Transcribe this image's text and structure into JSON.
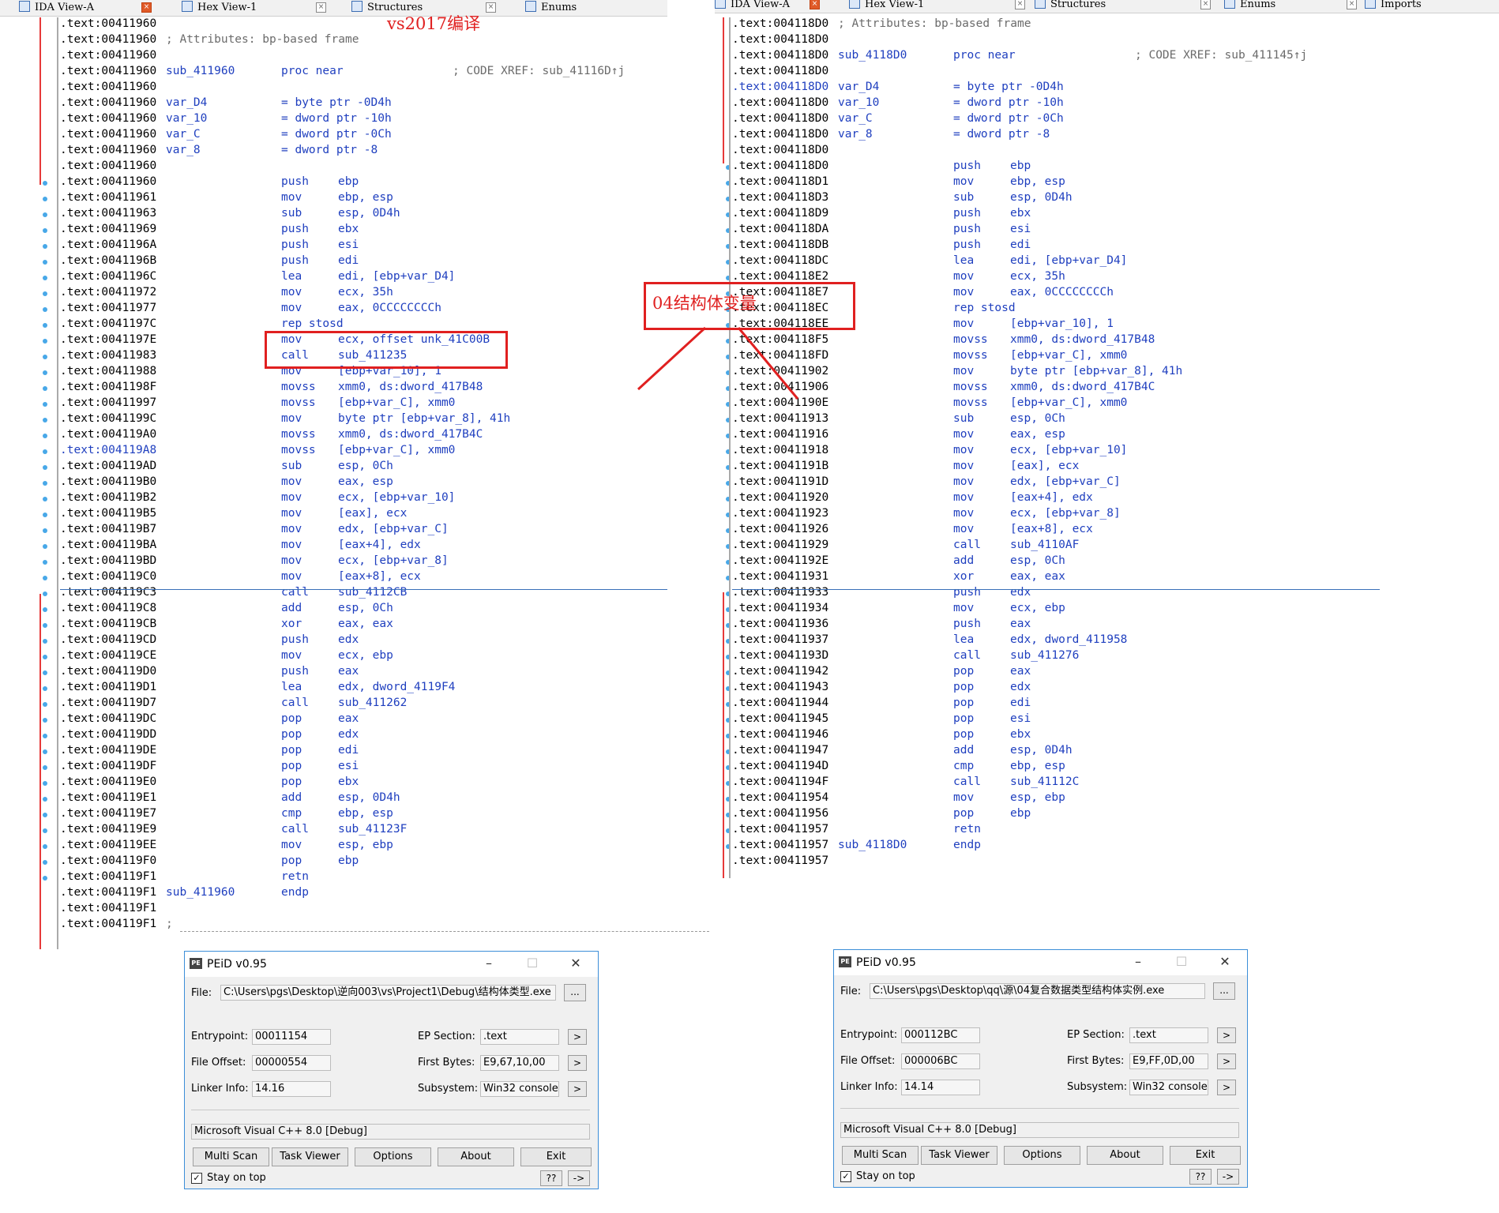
{
  "annotations": {
    "left_title": "vs2017编译",
    "middle_label": "04结构体变量"
  },
  "left": {
    "tabs": [
      {
        "label": "IDA View-A",
        "icon": "ida-view-icon"
      },
      {
        "label": "Hex View-1",
        "icon": "hex-view-icon"
      },
      {
        "label": "Structures",
        "icon": "structures-icon"
      },
      {
        "label": "Enums",
        "icon": "enums-icon"
      }
    ],
    "lines": [
      {
        "a": ".text:00411960",
        "l": "",
        "m": "",
        "o": "",
        "c": ""
      },
      {
        "a": ".text:00411960",
        "l": "",
        "m": "",
        "o": "",
        "c": "; Attributes: bp-based frame"
      },
      {
        "a": ".text:00411960",
        "l": "",
        "m": "",
        "o": "",
        "c": ""
      },
      {
        "a": ".text:00411960",
        "l": "sub_411960",
        "m": "proc near",
        "o": "",
        "c": "; CODE XREF: sub_41116D↑j"
      },
      {
        "a": ".text:00411960",
        "l": "",
        "m": "",
        "o": "",
        "c": ""
      },
      {
        "a": ".text:00411960",
        "l": "var_D4",
        "m": "= byte ptr -0D4h",
        "o": "",
        "c": ""
      },
      {
        "a": ".text:00411960",
        "l": "var_10",
        "m": "= dword ptr -10h",
        "o": "",
        "c": ""
      },
      {
        "a": ".text:00411960",
        "l": "var_C",
        "m": "= dword ptr -0Ch",
        "o": "",
        "c": ""
      },
      {
        "a": ".text:00411960",
        "l": "var_8",
        "m": "= dword ptr -8",
        "o": "",
        "c": ""
      },
      {
        "a": ".text:00411960",
        "l": "",
        "m": "",
        "o": "",
        "c": ""
      },
      {
        "a": ".text:00411960",
        "l": "",
        "m": "push",
        "o": "ebp",
        "c": ""
      },
      {
        "a": ".text:00411961",
        "l": "",
        "m": "mov",
        "o": "ebp, esp",
        "c": ""
      },
      {
        "a": ".text:00411963",
        "l": "",
        "m": "sub",
        "o": "esp, 0D4h",
        "c": ""
      },
      {
        "a": ".text:00411969",
        "l": "",
        "m": "push",
        "o": "ebx",
        "c": ""
      },
      {
        "a": ".text:0041196A",
        "l": "",
        "m": "push",
        "o": "esi",
        "c": ""
      },
      {
        "a": ".text:0041196B",
        "l": "",
        "m": "push",
        "o": "edi",
        "c": ""
      },
      {
        "a": ".text:0041196C",
        "l": "",
        "m": "lea",
        "o": "edi, [ebp+var_D4]",
        "c": ""
      },
      {
        "a": ".text:00411972",
        "l": "",
        "m": "mov",
        "o": "ecx, 35h",
        "c": ""
      },
      {
        "a": ".text:00411977",
        "l": "",
        "m": "mov",
        "o": "eax, 0CCCCCCCCh",
        "c": ""
      },
      {
        "a": ".text:0041197C",
        "l": "",
        "m": "rep stosd",
        "o": "",
        "c": ""
      },
      {
        "a": ".text:0041197E",
        "l": "",
        "m": "mov",
        "o": "ecx, offset unk_41C00B",
        "c": ""
      },
      {
        "a": ".text:00411983",
        "l": "",
        "m": "call",
        "o": "sub_411235",
        "c": ""
      },
      {
        "a": ".text:00411988",
        "l": "",
        "m": "mov",
        "o": "[ebp+var_10], 1",
        "c": ""
      },
      {
        "a": ".text:0041198F",
        "l": "",
        "m": "movss",
        "o": "xmm0, ds:dword_417B48",
        "c": ""
      },
      {
        "a": ".text:00411997",
        "l": "",
        "m": "movss",
        "o": "[ebp+var_C], xmm0",
        "c": ""
      },
      {
        "a": ".text:0041199C",
        "l": "",
        "m": "mov",
        "o": "byte ptr [ebp+var_8], 41h",
        "c": ""
      },
      {
        "a": ".text:004119A0",
        "l": "",
        "m": "movss",
        "o": "xmm0, ds:dword_417B4C",
        "c": ""
      },
      {
        "a": ".text:004119A8",
        "l": "",
        "m": "movss",
        "o": "[ebp+var_C], xmm0",
        "c": "",
        "hl": true
      },
      {
        "a": ".text:004119AD",
        "l": "",
        "m": "sub",
        "o": "esp, 0Ch",
        "c": ""
      },
      {
        "a": ".text:004119B0",
        "l": "",
        "m": "mov",
        "o": "eax, esp",
        "c": ""
      },
      {
        "a": ".text:004119B2",
        "l": "",
        "m": "mov",
        "o": "ecx, [ebp+var_10]",
        "c": ""
      },
      {
        "a": ".text:004119B5",
        "l": "",
        "m": "mov",
        "o": "[eax], ecx",
        "c": ""
      },
      {
        "a": ".text:004119B7",
        "l": "",
        "m": "mov",
        "o": "edx, [ebp+var_C]",
        "c": ""
      },
      {
        "a": ".text:004119BA",
        "l": "",
        "m": "mov",
        "o": "[eax+4], edx",
        "c": ""
      },
      {
        "a": ".text:004119BD",
        "l": "",
        "m": "mov",
        "o": "ecx, [ebp+var_8]",
        "c": ""
      },
      {
        "a": ".text:004119C0",
        "l": "",
        "m": "mov",
        "o": "[eax+8], ecx",
        "c": ""
      },
      {
        "a": ".text:004119C3",
        "l": "",
        "m": "call",
        "o": "sub_4112CB",
        "c": ""
      },
      {
        "a": ".text:004119C8",
        "l": "",
        "m": "add",
        "o": "esp, 0Ch",
        "c": ""
      },
      {
        "a": ".text:004119CB",
        "l": "",
        "m": "xor",
        "o": "eax, eax",
        "c": ""
      },
      {
        "a": ".text:004119CD",
        "l": "",
        "m": "push",
        "o": "edx",
        "c": ""
      },
      {
        "a": ".text:004119CE",
        "l": "",
        "m": "mov",
        "o": "ecx, ebp",
        "c": ""
      },
      {
        "a": ".text:004119D0",
        "l": "",
        "m": "push",
        "o": "eax",
        "c": ""
      },
      {
        "a": ".text:004119D1",
        "l": "",
        "m": "lea",
        "o": "edx, dword_4119F4",
        "c": ""
      },
      {
        "a": ".text:004119D7",
        "l": "",
        "m": "call",
        "o": "sub_411262",
        "c": ""
      },
      {
        "a": ".text:004119DC",
        "l": "",
        "m": "pop",
        "o": "eax",
        "c": ""
      },
      {
        "a": ".text:004119DD",
        "l": "",
        "m": "pop",
        "o": "edx",
        "c": ""
      },
      {
        "a": ".text:004119DE",
        "l": "",
        "m": "pop",
        "o": "edi",
        "c": ""
      },
      {
        "a": ".text:004119DF",
        "l": "",
        "m": "pop",
        "o": "esi",
        "c": ""
      },
      {
        "a": ".text:004119E0",
        "l": "",
        "m": "pop",
        "o": "ebx",
        "c": ""
      },
      {
        "a": ".text:004119E1",
        "l": "",
        "m": "add",
        "o": "esp, 0D4h",
        "c": ""
      },
      {
        "a": ".text:004119E7",
        "l": "",
        "m": "cmp",
        "o": "ebp, esp",
        "c": ""
      },
      {
        "a": ".text:004119E9",
        "l": "",
        "m": "call",
        "o": "sub_41123F",
        "c": ""
      },
      {
        "a": ".text:004119EE",
        "l": "",
        "m": "mov",
        "o": "esp, ebp",
        "c": ""
      },
      {
        "a": ".text:004119F0",
        "l": "",
        "m": "pop",
        "o": "ebp",
        "c": ""
      },
      {
        "a": ".text:004119F1",
        "l": "",
        "m": "retn",
        "o": "",
        "c": ""
      },
      {
        "a": ".text:004119F1",
        "l": "sub_411960",
        "m": "endp",
        "o": "",
        "c": ""
      },
      {
        "a": ".text:004119F1",
        "l": "",
        "m": "",
        "o": "",
        "c": ""
      },
      {
        "a": ".text:004119F1",
        "l": "",
        "m": "",
        "o": "",
        "c": ";"
      }
    ]
  },
  "right": {
    "tabs": [
      {
        "label": "IDA View-A",
        "icon": "ida-view-icon"
      },
      {
        "label": "Hex View-1",
        "icon": "hex-view-icon"
      },
      {
        "label": "Structures",
        "icon": "structures-icon"
      },
      {
        "label": "Enums",
        "icon": "enums-icon"
      },
      {
        "label": "Imports",
        "icon": "imports-icon"
      }
    ],
    "lines": [
      {
        "a": ".text:004118D0",
        "l": "",
        "m": "",
        "o": "",
        "c": "; Attributes: bp-based frame"
      },
      {
        "a": ".text:004118D0",
        "l": "",
        "m": "",
        "o": "",
        "c": ""
      },
      {
        "a": ".text:004118D0",
        "l": "sub_4118D0",
        "m": "proc near",
        "o": "",
        "c": "; CODE XREF: sub_411145↑j"
      },
      {
        "a": ".text:004118D0",
        "l": "",
        "m": "",
        "o": "",
        "c": ""
      },
      {
        "a": ".text:004118D0",
        "l": "var_D4",
        "m": "= byte ptr -0D4h",
        "o": "",
        "c": "",
        "hl": true
      },
      {
        "a": ".text:004118D0",
        "l": "var_10",
        "m": "= dword ptr -10h",
        "o": "",
        "c": ""
      },
      {
        "a": ".text:004118D0",
        "l": "var_C",
        "m": "= dword ptr -0Ch",
        "o": "",
        "c": ""
      },
      {
        "a": ".text:004118D0",
        "l": "var_8",
        "m": "= dword ptr -8",
        "o": "",
        "c": ""
      },
      {
        "a": ".text:004118D0",
        "l": "",
        "m": "",
        "o": "",
        "c": ""
      },
      {
        "a": ".text:004118D0",
        "l": "",
        "m": "push",
        "o": "ebp",
        "c": ""
      },
      {
        "a": ".text:004118D1",
        "l": "",
        "m": "mov",
        "o": "ebp, esp",
        "c": ""
      },
      {
        "a": ".text:004118D3",
        "l": "",
        "m": "sub",
        "o": "esp, 0D4h",
        "c": ""
      },
      {
        "a": ".text:004118D9",
        "l": "",
        "m": "push",
        "o": "ebx",
        "c": ""
      },
      {
        "a": ".text:004118DA",
        "l": "",
        "m": "push",
        "o": "esi",
        "c": ""
      },
      {
        "a": ".text:004118DB",
        "l": "",
        "m": "push",
        "o": "edi",
        "c": ""
      },
      {
        "a": ".text:004118DC",
        "l": "",
        "m": "lea",
        "o": "edi, [ebp+var_D4]",
        "c": ""
      },
      {
        "a": ".text:004118E2",
        "l": "",
        "m": "mov",
        "o": "ecx, 35h",
        "c": ""
      },
      {
        "a": ".text:004118E7",
        "l": "",
        "m": "mov",
        "o": "eax, 0CCCCCCCCh",
        "c": ""
      },
      {
        "a": ".text:004118EC",
        "l": "",
        "m": "rep stosd",
        "o": "",
        "c": ""
      },
      {
        "a": ".text:004118EE",
        "l": "",
        "m": "mov",
        "o": "[ebp+var_10], 1",
        "c": ""
      },
      {
        "a": ".text:004118F5",
        "l": "",
        "m": "movss",
        "o": "xmm0, ds:dword_417B48",
        "c": ""
      },
      {
        "a": ".text:004118FD",
        "l": "",
        "m": "movss",
        "o": "[ebp+var_C], xmm0",
        "c": ""
      },
      {
        "a": ".text:00411902",
        "l": "",
        "m": "mov",
        "o": "byte ptr [ebp+var_8], 41h",
        "c": ""
      },
      {
        "a": ".text:00411906",
        "l": "",
        "m": "movss",
        "o": "xmm0, ds:dword_417B4C",
        "c": ""
      },
      {
        "a": ".text:0041190E",
        "l": "",
        "m": "movss",
        "o": "[ebp+var_C], xmm0",
        "c": ""
      },
      {
        "a": ".text:00411913",
        "l": "",
        "m": "sub",
        "o": "esp, 0Ch",
        "c": ""
      },
      {
        "a": ".text:00411916",
        "l": "",
        "m": "mov",
        "o": "eax, esp",
        "c": ""
      },
      {
        "a": ".text:00411918",
        "l": "",
        "m": "mov",
        "o": "ecx, [ebp+var_10]",
        "c": ""
      },
      {
        "a": ".text:0041191B",
        "l": "",
        "m": "mov",
        "o": "[eax], ecx",
        "c": ""
      },
      {
        "a": ".text:0041191D",
        "l": "",
        "m": "mov",
        "o": "edx, [ebp+var_C]",
        "c": ""
      },
      {
        "a": ".text:00411920",
        "l": "",
        "m": "mov",
        "o": "[eax+4], edx",
        "c": ""
      },
      {
        "a": ".text:00411923",
        "l": "",
        "m": "mov",
        "o": "ecx, [ebp+var_8]",
        "c": ""
      },
      {
        "a": ".text:00411926",
        "l": "",
        "m": "mov",
        "o": "[eax+8], ecx",
        "c": ""
      },
      {
        "a": ".text:00411929",
        "l": "",
        "m": "call",
        "o": "sub_4110AF",
        "c": ""
      },
      {
        "a": ".text:0041192E",
        "l": "",
        "m": "add",
        "o": "esp, 0Ch",
        "c": ""
      },
      {
        "a": ".text:00411931",
        "l": "",
        "m": "xor",
        "o": "eax, eax",
        "c": ""
      },
      {
        "a": ".text:00411933",
        "l": "",
        "m": "push",
        "o": "edx",
        "c": ""
      },
      {
        "a": ".text:00411934",
        "l": "",
        "m": "mov",
        "o": "ecx, ebp",
        "c": ""
      },
      {
        "a": ".text:00411936",
        "l": "",
        "m": "push",
        "o": "eax",
        "c": ""
      },
      {
        "a": ".text:00411937",
        "l": "",
        "m": "lea",
        "o": "edx, dword_411958",
        "c": ""
      },
      {
        "a": ".text:0041193D",
        "l": "",
        "m": "call",
        "o": "sub_411276",
        "c": ""
      },
      {
        "a": ".text:00411942",
        "l": "",
        "m": "pop",
        "o": "eax",
        "c": ""
      },
      {
        "a": ".text:00411943",
        "l": "",
        "m": "pop",
        "o": "edx",
        "c": ""
      },
      {
        "a": ".text:00411944",
        "l": "",
        "m": "pop",
        "o": "edi",
        "c": ""
      },
      {
        "a": ".text:00411945",
        "l": "",
        "m": "pop",
        "o": "esi",
        "c": ""
      },
      {
        "a": ".text:00411946",
        "l": "",
        "m": "pop",
        "o": "ebx",
        "c": ""
      },
      {
        "a": ".text:00411947",
        "l": "",
        "m": "add",
        "o": "esp, 0D4h",
        "c": ""
      },
      {
        "a": ".text:0041194D",
        "l": "",
        "m": "cmp",
        "o": "ebp, esp",
        "c": ""
      },
      {
        "a": ".text:0041194F",
        "l": "",
        "m": "call",
        "o": "sub_41112C",
        "c": ""
      },
      {
        "a": ".text:00411954",
        "l": "",
        "m": "mov",
        "o": "esp, ebp",
        "c": ""
      },
      {
        "a": ".text:00411956",
        "l": "",
        "m": "pop",
        "o": "ebp",
        "c": ""
      },
      {
        "a": ".text:00411957",
        "l": "",
        "m": "retn",
        "o": "",
        "c": ""
      },
      {
        "a": ".text:00411957",
        "l": "sub_4118D0",
        "m": "endp",
        "o": "",
        "c": ""
      },
      {
        "a": ".text:00411957",
        "l": "",
        "m": "",
        "o": "",
        "c": ""
      }
    ]
  },
  "peid_left": {
    "title": "PEiD v0.95",
    "file_label": "File:",
    "file_path": "C:\\Users\\pgs\\Desktop\\逆向003\\vs\\Project1\\Debug\\结构体类型.exe",
    "browse": "...",
    "entrypoint_label": "Entrypoint:",
    "entrypoint": "00011154",
    "file_offset_label": "File Offset:",
    "file_offset": "00000554",
    "linker_label": "Linker Info:",
    "linker": "14.16",
    "ep_section_label": "EP Section:",
    "ep_section": ".text",
    "first_bytes_label": "First Bytes:",
    "first_bytes": "E9,67,10,00",
    "subsystem_label": "Subsystem:",
    "subsystem": "Win32 console",
    "detect": "Microsoft Visual C++ 8.0 [Debug]",
    "arrow": ">",
    "buttons": {
      "multi_scan": "Multi Scan",
      "task_viewer": "Task Viewer",
      "options": "Options",
      "about": "About",
      "exit": "Exit"
    },
    "stay_on_top": "Stay on top",
    "help": "??",
    "more": "->",
    "checkmark": "✓",
    "icon": "peid-app-icon"
  },
  "peid_right": {
    "title": "PEiD v0.95",
    "file_label": "File:",
    "file_path": "C:\\Users\\pgs\\Desktop\\qq\\源\\04复合数据类型结构体实例.exe",
    "browse": "...",
    "entrypoint_label": "Entrypoint:",
    "entrypoint": "000112BC",
    "file_offset_label": "File Offset:",
    "file_offset": "000006BC",
    "linker_label": "Linker Info:",
    "linker": "14.14",
    "ep_section_label": "EP Section:",
    "ep_section": ".text",
    "first_bytes_label": "First Bytes:",
    "first_bytes": "E9,FF,0D,00",
    "subsystem_label": "Subsystem:",
    "subsystem": "Win32 console",
    "detect": "Microsoft Visual C++ 8.0 [Debug]",
    "arrow": ">",
    "buttons": {
      "multi_scan": "Multi Scan",
      "task_viewer": "Task Viewer",
      "options": "Options",
      "about": "About",
      "exit": "Exit"
    },
    "stay_on_top": "Stay on top",
    "help": "??",
    "more": "->",
    "checkmark": "✓",
    "icon": "peid-app-icon"
  },
  "colors": {
    "code_blue": "#1f3fbf",
    "comment_gray": "#6b6b6b",
    "annotation_red": "#e02020",
    "flow_red": "#e63a3a",
    "breakpoint_dot": "#48a8e8"
  }
}
